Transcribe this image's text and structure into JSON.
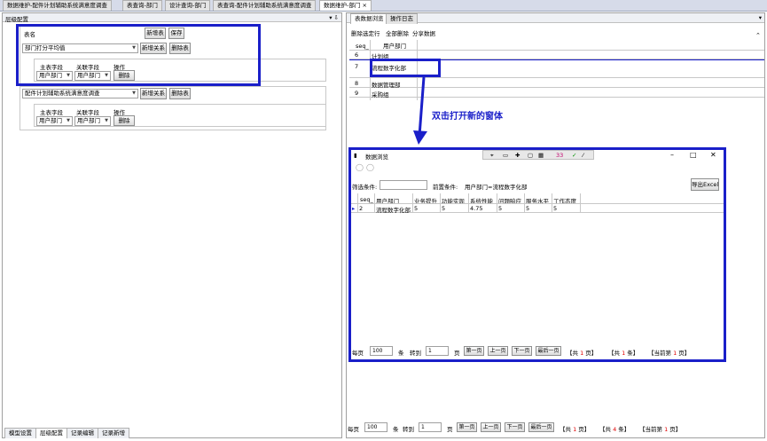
{
  "doc_tabs": [
    "数据维护-配件计划辅助系统满意度调查",
    "表查询-部门",
    "设计查询-部门",
    "表查询-配件计划辅助系统满意度调查",
    "数据维护-部门"
  ],
  "active_tab_close": "×",
  "left_panel": {
    "title": "层级配置",
    "pin": "▾ ⇩",
    "table_label": "表名",
    "new_table_btn": "新增表",
    "save_btn": "保存",
    "block1": {
      "table_value": "部门打分平均值",
      "add_relation_btn": "新增关系",
      "delete_table_btn": "删除表",
      "col_main": "主表字段",
      "col_rel": "关联字段",
      "col_op": "操作",
      "row_main": "用户部门",
      "row_rel": "用户部门",
      "row_delete": "删除"
    },
    "block2": {
      "table_value": "配件计划辅助系统满意度调查",
      "add_relation_btn": "新增关系",
      "delete_table_btn": "删除表",
      "col_main": "主表字段",
      "col_rel": "关联字段",
      "col_op": "操作",
      "row_main": "用户部门",
      "row_rel": "用户部门",
      "row_delete": "删除"
    },
    "bottom_tabs": [
      "模型设置",
      "层级配置",
      "记录编辑",
      "记录新增"
    ]
  },
  "right_panel": {
    "tabs": [
      "表数据浏览",
      "操作日志"
    ],
    "toolbar": [
      "删除选定行",
      "全部删除",
      "分享数据"
    ],
    "headers": [
      "seq_",
      "用户部门"
    ],
    "rows": [
      {
        "seq": "6",
        "dept": "计划组"
      },
      {
        "seq": "7",
        "dept": "流程数字化部"
      },
      {
        "seq": "8",
        "dept": "数据管理部"
      },
      {
        "seq": "9",
        "dept": "采购组"
      }
    ],
    "pager": {
      "per_page": "每页",
      "per_page_val": "100",
      "unit": "条",
      "goto": "转到",
      "goto_val": "1",
      "page": "页",
      "first": "第一页",
      "prev": "上一页",
      "next": "下一页",
      "last": "最后一页",
      "total_pages_pre": "【共",
      "total_pages_val": "1",
      "total_pages_suf": "页】",
      "total_rows_pre": "【共",
      "total_rows_val": "4",
      "total_rows_suf": "条】",
      "current_pre": "【当前第",
      "current_val": "1",
      "current_suf": "页】"
    }
  },
  "annotation": "双击打开新的窗体",
  "popup": {
    "title": "数据浏览",
    "toolbar_num": "33",
    "filter_label": "筛选条件:",
    "pre_cond_label": "前置条件:",
    "pre_cond_value": "用户部门=流程数字化部",
    "export_btn": "导出Excel",
    "headers": [
      "seq_",
      "用户部门",
      "业务提升",
      "功能实现",
      "系统性能",
      "问题响应",
      "服务水平",
      "工作态度"
    ],
    "row": [
      "2",
      "流程数字化部",
      "5",
      "5",
      "4.75",
      "5",
      "5",
      "5"
    ],
    "pager": {
      "per_page": "每页",
      "per_page_val": "100",
      "unit": "条",
      "goto": "转到",
      "goto_val": "1",
      "page": "页",
      "first": "第一页",
      "prev": "上一页",
      "next": "下一页",
      "last": "最后一页",
      "total_pages_pre": "【共",
      "total_pages_val": "1",
      "total_pages_suf": "页】",
      "total_rows_pre": "【共",
      "total_rows_val": "1",
      "total_rows_suf": "条】",
      "current_pre": "【当前第",
      "current_val": "1",
      "current_suf": "页】"
    }
  },
  "colors": {
    "annotation_blue": "#1a1fc9",
    "active_tab": "#ffffff",
    "count_red": "#e00000"
  }
}
